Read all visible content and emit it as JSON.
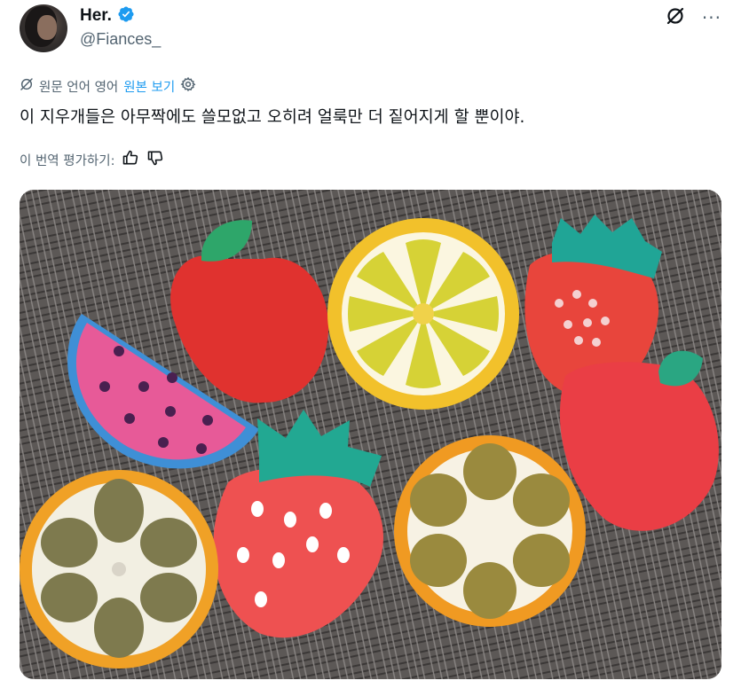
{
  "author": {
    "display_name": "Her.",
    "handle": "@Fiances_",
    "verified": true,
    "verified_color": "#1d9bf0"
  },
  "top_actions": {
    "grok_icon": "grok-icon",
    "more_label": "···"
  },
  "translation": {
    "source_label": "원문 언어 영어",
    "view_original_label": "원본 보기",
    "link_color": "#1d9bf0"
  },
  "tweet": {
    "text": "이 지우개들은 아무짝에도 쓸모없고 오히려 얼룩만 더 짙어지게 할 뿐이야."
  },
  "rating": {
    "label": "이 번역 평가하기:"
  },
  "media": {
    "type": "photo",
    "content": "fruit-shaped-erasers"
  }
}
